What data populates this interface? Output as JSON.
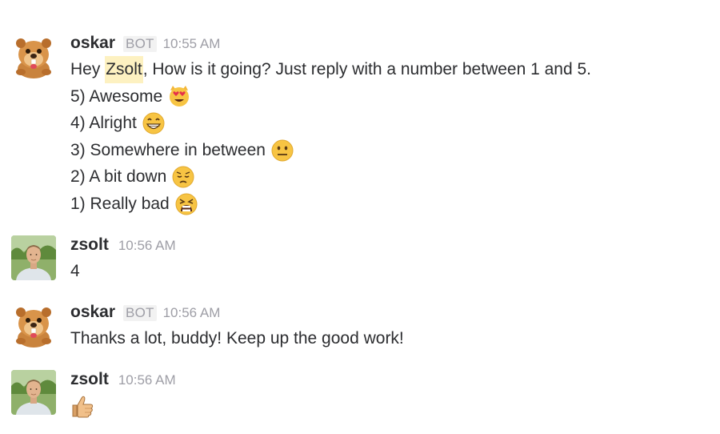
{
  "messages": [
    {
      "sender": "oskar",
      "badge": "BOT",
      "time": "10:55 AM",
      "greeting_prefix": "Hey ",
      "mention": "Zsolt",
      "greeting_suffix": ", How is it going? Just reply with a number between 1 and 5.",
      "options": [
        {
          "text": "5) Awesome",
          "emoji": "heart-eyes-cat-icon"
        },
        {
          "text": "4) Alright",
          "emoji": "grinning-face-icon"
        },
        {
          "text": "3) Somewhere in between",
          "emoji": "neutral-face-icon"
        },
        {
          "text": "2) A bit down",
          "emoji": "pensive-face-icon"
        },
        {
          "text": "1) Really bad",
          "emoji": "tired-face-icon"
        }
      ]
    },
    {
      "sender": "zsolt",
      "time": "10:56 AM",
      "text": "4"
    },
    {
      "sender": "oskar",
      "badge": "BOT",
      "time": "10:56 AM",
      "text": "Thanks a lot, buddy! Keep up the good work!"
    },
    {
      "sender": "zsolt",
      "time": "10:56 AM",
      "emoji": "thumbs-up-icon"
    }
  ],
  "colors": {
    "mention_bg": "#fdf1c1",
    "meta_text": "#9e9ea6",
    "body_text": "#2c2d30"
  }
}
